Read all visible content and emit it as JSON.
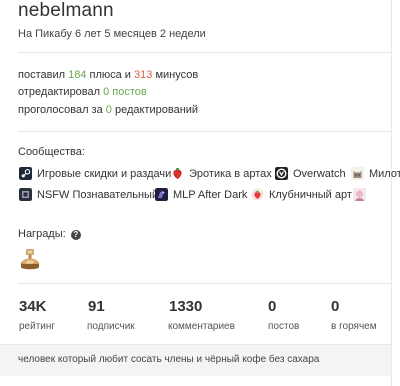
{
  "profile": {
    "username": "nebelmann",
    "since": "На Пикабу 6 лет 5 месяцев 2 недели"
  },
  "activity": {
    "line1_prefix": "поставил",
    "pluses": "184",
    "line1_mid": "плюса и",
    "minuses": "313",
    "line1_suffix": "минусов",
    "line2_prefix": "отредактировал",
    "edits": "0 постов",
    "line3_prefix": "проголосовал за",
    "votes": "0",
    "line3_suffix": "редактирований"
  },
  "communities": {
    "title": "Сообщества:",
    "items": [
      {
        "label": "Игровые скидки и раздачи",
        "icon": "steam-icon"
      },
      {
        "label": "Эротика в артах",
        "icon": "strawberry-icon"
      },
      {
        "label": "Overwatch",
        "icon": "overwatch-icon"
      },
      {
        "label": "Милота",
        "icon": "cat-icon"
      },
      {
        "label": "NSFW Познавательный",
        "icon": "nsfw-icon"
      },
      {
        "label": "MLP After Dark",
        "icon": "pony-icon"
      },
      {
        "label": "Клубничный арт",
        "icon": "strawberry-art-icon"
      },
      {
        "label": "",
        "icon": "anime-icon"
      }
    ]
  },
  "awards": {
    "title": "Награды:",
    "items": [
      {
        "icon": "award-medal-icon"
      }
    ]
  },
  "stats": [
    {
      "value": "34K",
      "label": "рейтинг"
    },
    {
      "value": "91",
      "label": "подписчик"
    },
    {
      "value": "1330",
      "label": "комментариев"
    },
    {
      "value": "0",
      "label": "постов"
    },
    {
      "value": "0",
      "label": "в горячем"
    }
  ],
  "bio": "человек который любит сосать члены и чёрный кофе без сахара",
  "colors": {
    "plus": "#6aa84f",
    "minus": "#e06246"
  }
}
